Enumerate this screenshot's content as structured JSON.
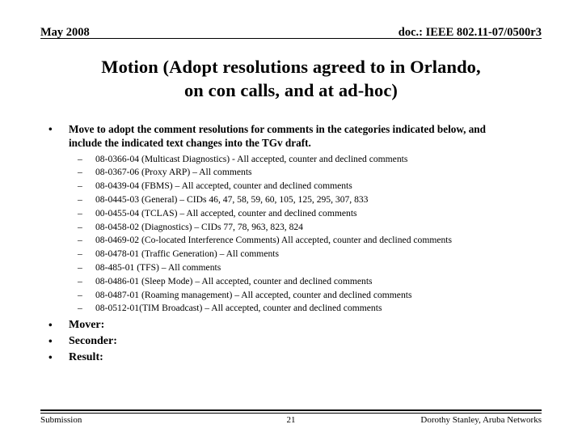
{
  "header": {
    "left": "May 2008",
    "right": "doc.: IEEE 802.11-07/0500r3"
  },
  "title": {
    "line1": "Motion  (Adopt resolutions agreed to in Orlando,",
    "line2": "on con calls, and at ad-hoc)"
  },
  "body": {
    "bullet_glyph": "•",
    "dash_glyph": "–",
    "lead_bullet": "Move to adopt the comment resolutions for comments in the categories indicated below, and include the indicated text changes into the TGv draft.",
    "sub_items": [
      "08-0366-04 (Multicast Diagnostics) - All accepted, counter and declined comments",
      "08-0367-06 (Proxy ARP) – All comments",
      "08-0439-04 (FBMS) – All accepted, counter and declined comments",
      "08-0445-03 (General) – CIDs 46, 47, 58, 59, 60, 105, 125, 295, 307, 833",
      "00-0455-04 (TCLAS) – All accepted, counter and declined comments",
      "08-0458-02 (Diagnostics) – CIDs 77, 78, 963, 823, 824",
      "08-0469-02 (Co-located Interference Comments) All accepted, counter and declined comments",
      "08-0478-01 (Traffic Generation) – All comments",
      "08-485-01 (TFS) – All comments",
      "08-0486-01 (Sleep Mode) – All accepted, counter and declined comments",
      "08-0487-01 (Roaming management) – All accepted, counter and declined comments",
      "08-0512-01(TIM Broadcast) – All accepted, counter and declined comments"
    ],
    "closers": [
      "Mover:",
      "Seconder:",
      "Result:"
    ]
  },
  "footer": {
    "left": "Submission",
    "page_number": "21",
    "right": "Dorothy Stanley, Aruba Networks"
  }
}
